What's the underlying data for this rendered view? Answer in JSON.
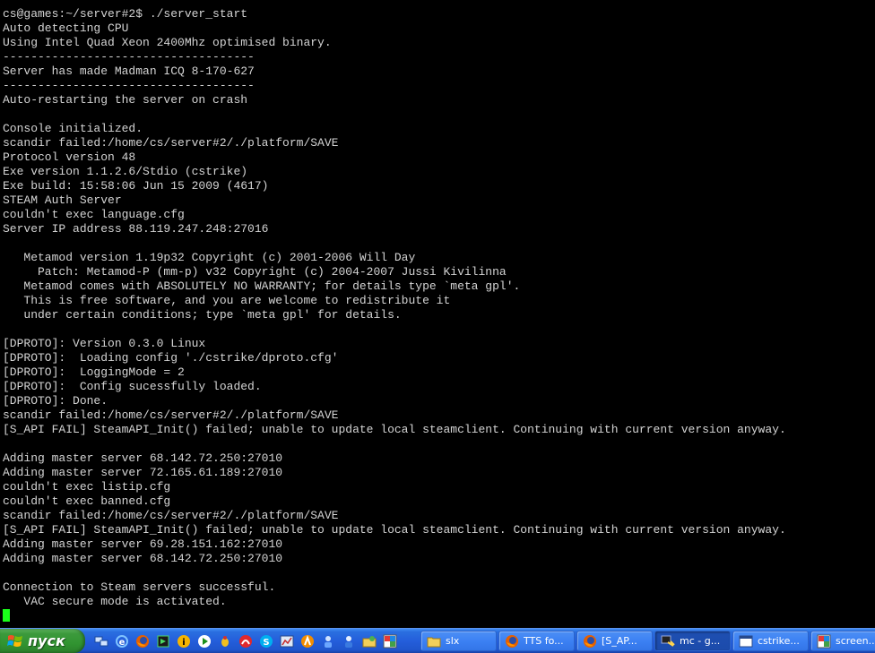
{
  "terminal": {
    "lines": [
      "cs@games:~/server#2$ ./server_start",
      "Auto detecting CPU",
      "Using Intel Quad Xeon 2400Mhz optimised binary.",
      "------------------------------------",
      "Server has made Madman ICQ 8-170-627",
      "------------------------------------",
      "Auto-restarting the server on crash",
      "",
      "Console initialized.",
      "scandir failed:/home/cs/server#2/./platform/SAVE",
      "Protocol version 48",
      "Exe version 1.1.2.6/Stdio (cstrike)",
      "Exe build: 15:58:06 Jun 15 2009 (4617)",
      "STEAM Auth Server",
      "couldn't exec language.cfg",
      "Server IP address 88.119.247.248:27016",
      "",
      "   Metamod version 1.19p32 Copyright (c) 2001-2006 Will Day",
      "     Patch: Metamod-P (mm-p) v32 Copyright (c) 2004-2007 Jussi Kivilinna",
      "   Metamod comes with ABSOLUTELY NO WARRANTY; for details type `meta gpl'.",
      "   This is free software, and you are welcome to redistribute it",
      "   under certain conditions; type `meta gpl' for details.",
      "",
      "[DPROTO]: Version 0.3.0 Linux",
      "[DPROTO]:  Loading config './cstrike/dproto.cfg'",
      "[DPROTO]:  LoggingMode = 2",
      "[DPROTO]:  Config sucessfully loaded.",
      "[DPROTO]: Done.",
      "scandir failed:/home/cs/server#2/./platform/SAVE",
      "[S_API FAIL] SteamAPI_Init() failed; unable to update local steamclient. Continuing with current version anyway.",
      "",
      "Adding master server 68.142.72.250:27010",
      "Adding master server 72.165.61.189:27010",
      "couldn't exec listip.cfg",
      "couldn't exec banned.cfg",
      "scandir failed:/home/cs/server#2/./platform/SAVE",
      "[S_API FAIL] SteamAPI_Init() failed; unable to update local steamclient. Continuing with current version anyway.",
      "Adding master server 69.28.151.162:27010",
      "Adding master server 68.142.72.250:27010",
      "",
      "Connection to Steam servers successful.",
      "   VAC secure mode is activated."
    ],
    "text_color": "#d4d4d4",
    "cursor_color": "#1aff1a"
  },
  "taskbar": {
    "start_label": "пуск",
    "quicklaunch_icons": [
      "network-icon",
      "ie-icon",
      "firefox-icon",
      "media-icon",
      "info-icon",
      "player-icon",
      "bug-icon",
      "antivirus-icon",
      "skype-icon",
      "chart-icon",
      "avast-icon",
      "user-icon",
      "user2-icon",
      "folder-share-icon",
      "paint-icon"
    ],
    "tasks": [
      {
        "label": "slx",
        "icon": "folder-icon",
        "active": false
      },
      {
        "label": "TTS fo...",
        "icon": "firefox-icon",
        "active": false
      },
      {
        "label": "[S_AP...",
        "icon": "firefox-icon",
        "active": false
      },
      {
        "label": "mc - g...",
        "icon": "putty-icon",
        "active": true
      },
      {
        "label": "cstrike...",
        "icon": "window-icon",
        "active": false
      },
      {
        "label": "screen...",
        "icon": "paint-icon",
        "active": false
      }
    ]
  }
}
